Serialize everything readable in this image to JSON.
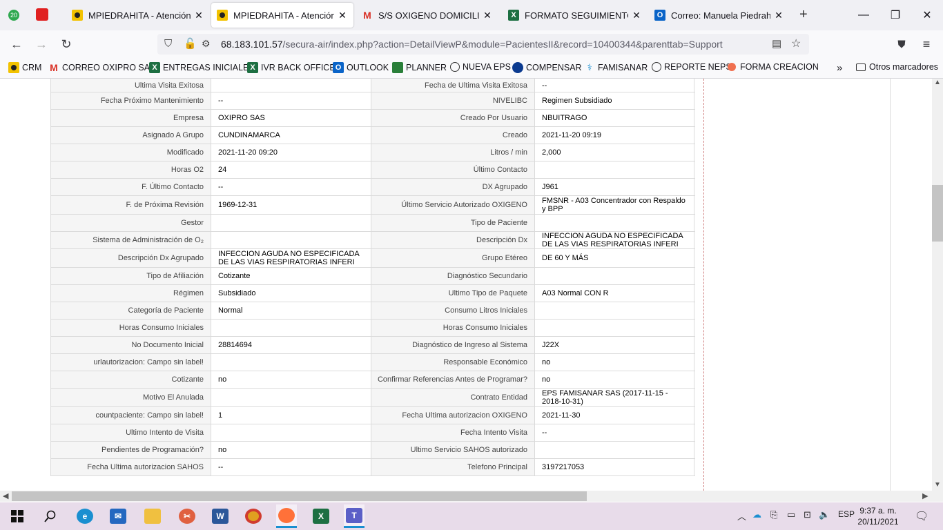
{
  "browser": {
    "tabs": [
      {
        "title": "MPIEDRAHITA - Atención al U",
        "icon": "oxipro-icon"
      },
      {
        "title": "MPIEDRAHITA - Atención al U",
        "icon": "oxipro-icon",
        "active": true
      },
      {
        "title": "S/S OXIGENO DOMICILIARIO",
        "icon": "gmail-icon"
      },
      {
        "title": "FORMATO SEGUIMIENTO GD",
        "icon": "excel-icon"
      },
      {
        "title": "Correo: Manuela Piedrahita -",
        "icon": "outlook-icon"
      }
    ],
    "tab_badge": "20",
    "url_host": "68.183.101.57",
    "url_path": "/secura-air/index.php?action=DetailViewP&module=PacientesII&record=10400344&parenttab=Support",
    "bookmarks": [
      {
        "label": "CRM",
        "icon": "oxipro-icon"
      },
      {
        "label": "CORREO OXIPRO SAS",
        "icon": "gmail-icon"
      },
      {
        "label": "ENTREGAS INICIALES",
        "icon": "excel-icon"
      },
      {
        "label": "IVR BACK OFFICE",
        "icon": "excel-icon"
      },
      {
        "label": "OUTLOOK",
        "icon": "outlook-icon"
      },
      {
        "label": "PLANNER",
        "icon": "planner-icon"
      },
      {
        "label": "NUEVA EPS",
        "icon": "globe-icon"
      },
      {
        "label": "COMPENSAR",
        "icon": "compensar-icon"
      },
      {
        "label": "FAMISANAR",
        "icon": "famisanar-icon"
      },
      {
        "label": "REPORTE NEPS",
        "icon": "globe-icon"
      },
      {
        "label": "FORMA CREACION",
        "icon": "forma-icon"
      }
    ],
    "other_bookmarks": "Otros marcadores"
  },
  "rows": [
    {
      "l1": "Ultima Visita Exitosa",
      "v1": "",
      "l2": "Fecha de Ultima Visita Exitosa",
      "v2": "--"
    },
    {
      "l1": "Fecha Próximo Mantenimiento",
      "v1": "--",
      "l2": "NIVELIBC",
      "v2": " Regimen Subsidiado"
    },
    {
      "l1": "Empresa",
      "v1": "OXIPRO SAS",
      "l2": "Creado Por Usuario",
      "v2": " NBUITRAGO"
    },
    {
      "l1": "Asignado A Grupo",
      "v1": " CUNDINAMARCA",
      "l2": "Creado",
      "v2": "2021-11-20 09:19"
    },
    {
      "l1": "Modificado",
      "v1": "2021-11-20 09:20",
      "l2": "Litros / min",
      "v2": " 2,000"
    },
    {
      "l1": "Horas O2",
      "v1": " 24",
      "l2": "Último Contacto",
      "v2": ""
    },
    {
      "l1": "F. Último Contacto",
      "v1": "--",
      "l2": "DX Agrupado",
      "v2": " J961"
    },
    {
      "l1": "F. de Próxima Revisión",
      "v1": "1969-12-31",
      "l2": "Último Servicio Autorizado OXIGENO",
      "v2": "FMSNR - A03 Concentrador con Respaldo y BPP"
    },
    {
      "l1": "Gestor",
      "v1": "",
      "l2": "Tipo de Paciente",
      "v2": ""
    },
    {
      "l1": "Sistema de Administración de O₂",
      "v1": "",
      "l2": "Descripción Dx",
      "v2": " INFECCION AGUDA NO ESPECIFICADA DE LAS VIAS RESPIRATORIAS INFERI"
    },
    {
      "l1": "Descripción Dx Agrupado",
      "v1": " INFECCION AGUDA NO ESPECIFICADA DE LAS VIAS RESPIRATORIAS INFERI",
      "l2": "Grupo Etéreo",
      "v2": " DE 60 Y MÁS"
    },
    {
      "l1": "Tipo de Afiliación",
      "v1": " Cotizante",
      "l2": "Diagnóstico Secundario",
      "v2": ""
    },
    {
      "l1": "Régimen",
      "v1": " Subsidiado",
      "l2": "Ultimo Tipo de Paquete",
      "v2": " A03 Normal CON R"
    },
    {
      "l1": "Categoría de Paciente",
      "v1": " Normal",
      "l2": "Consumo Litros Iniciales",
      "v2": ""
    },
    {
      "l1": "Horas Consumo Iniciales",
      "v1": "",
      "l2": "Horas Consumo Iniciales",
      "v2": ""
    },
    {
      "l1": "No Documento Inicial",
      "v1": " 28814694",
      "l2": "Diagnóstico de Ingreso al Sistema",
      "v2": " J22X"
    },
    {
      "l1": "urlautorizacion: Campo sin label!",
      "v1": "",
      "l2": "Responsable Económico",
      "v2": "no"
    },
    {
      "l1": "Cotizante",
      "v1": "no",
      "l2": "Confirmar Referencias Antes de Programar?",
      "v2": "no"
    },
    {
      "l1": "Motivo El Anulada",
      "v1": "",
      "l2": "Contrato Entidad",
      "v2": "EPS FAMISANAR SAS (2017-11-15 - 2018-10-31)"
    },
    {
      "l1": "countpaciente: Campo sin label!",
      "v1": " 1",
      "l2": "Fecha Ultima autorizacion OXIGENO",
      "v2": "2021-11-30"
    },
    {
      "l1": "Ultimo Intento de Visita",
      "v1": "",
      "l2": "Fecha Intento Visita",
      "v2": "--"
    },
    {
      "l1": "Pendientes de Programación?",
      "v1": "no",
      "l2": "Ultimo Servicio SAHOS autorizado",
      "v2": ""
    },
    {
      "l1": "Fecha Ultima autorizacion SAHOS",
      "v1": "--",
      "l2": "Telefono Principal",
      "v2": " 3197217053"
    }
  ],
  "taskbar": {
    "language": "ESP",
    "time": "9:37 a. m.",
    "date": "20/11/2021"
  }
}
